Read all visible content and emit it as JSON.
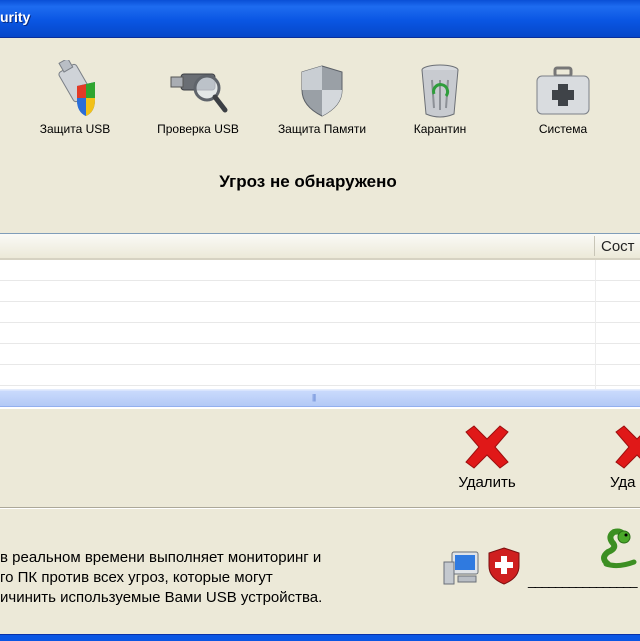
{
  "window": {
    "title": "urity"
  },
  "toolbar": {
    "items": [
      {
        "label": "Защита USB",
        "icon": "usb-shield-icon"
      },
      {
        "label": "Проверка USB",
        "icon": "usb-scan-magnifier-icon"
      },
      {
        "label": "Защита Памяти",
        "icon": "memory-shield-icon"
      },
      {
        "label": "Карантин",
        "icon": "recycle-bin-icon"
      },
      {
        "label": "Система",
        "icon": "medical-kit-icon"
      }
    ]
  },
  "status": {
    "heading": "Угроз не обнаружено"
  },
  "threat_list": {
    "columns": [
      "",
      "Сост"
    ],
    "rows": []
  },
  "actions": {
    "delete_label": "Удалить",
    "delete_partial_label": "Уда"
  },
  "info": {
    "lines": [
      "в реальном времени выполняет мониторинг и",
      "го ПК против всех угроз, которые могут",
      "ичинить используемые Вами  USB устройства."
    ],
    "dash_text": "________________",
    "icons": [
      "computer-icon",
      "shield-cross-icon",
      "snake-mascot-icon"
    ]
  },
  "colors": {
    "titlebar": "#0A56E3",
    "window_bg": "#ECE9D8",
    "delete_red": "#E01818"
  }
}
